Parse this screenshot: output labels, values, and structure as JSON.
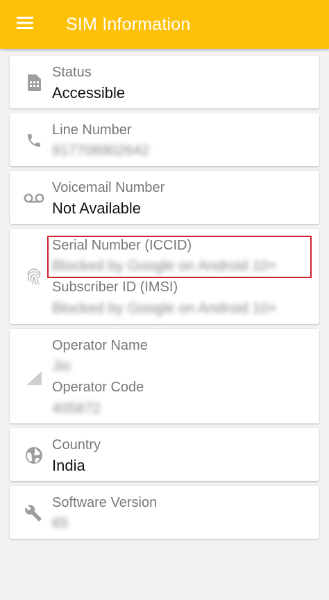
{
  "app_bar": {
    "title": "SIM Information",
    "menu_icon": "hamburger-menu-icon",
    "background": "#ffc107"
  },
  "cards": {
    "status": {
      "label": "Status",
      "value": "Accessible",
      "icon": "sim-card-icon"
    },
    "line_number": {
      "label": "Line Number",
      "value": "917708902642",
      "value_blurred": true,
      "icon": "phone-icon"
    },
    "voicemail": {
      "label": "Voicemail Number",
      "value": "Not Available",
      "icon": "voicemail-icon"
    },
    "serial": {
      "label": "Serial Number (ICCID)",
      "value": "Blocked by Google on Android 10+",
      "value_blurred": true,
      "highlighted": true,
      "highlight_color": "#d32030",
      "subscriber_label": "Subscriber ID (IMSI)",
      "subscriber_value": "Blocked by Google on Android 10+",
      "subscriber_value_blurred": true,
      "icon": "fingerprint-icon"
    },
    "operator": {
      "name_label": "Operator Name",
      "name_value": "Jio",
      "name_value_blurred": true,
      "code_label": "Operator Code",
      "code_value": "405872",
      "code_value_blurred": true,
      "icon": "signal-strength-icon"
    },
    "country": {
      "label": "Country",
      "value": "India",
      "icon": "globe-icon"
    },
    "software": {
      "label": "Software Version",
      "value": "65",
      "value_blurred": true,
      "icon": "wrench-icon"
    }
  }
}
